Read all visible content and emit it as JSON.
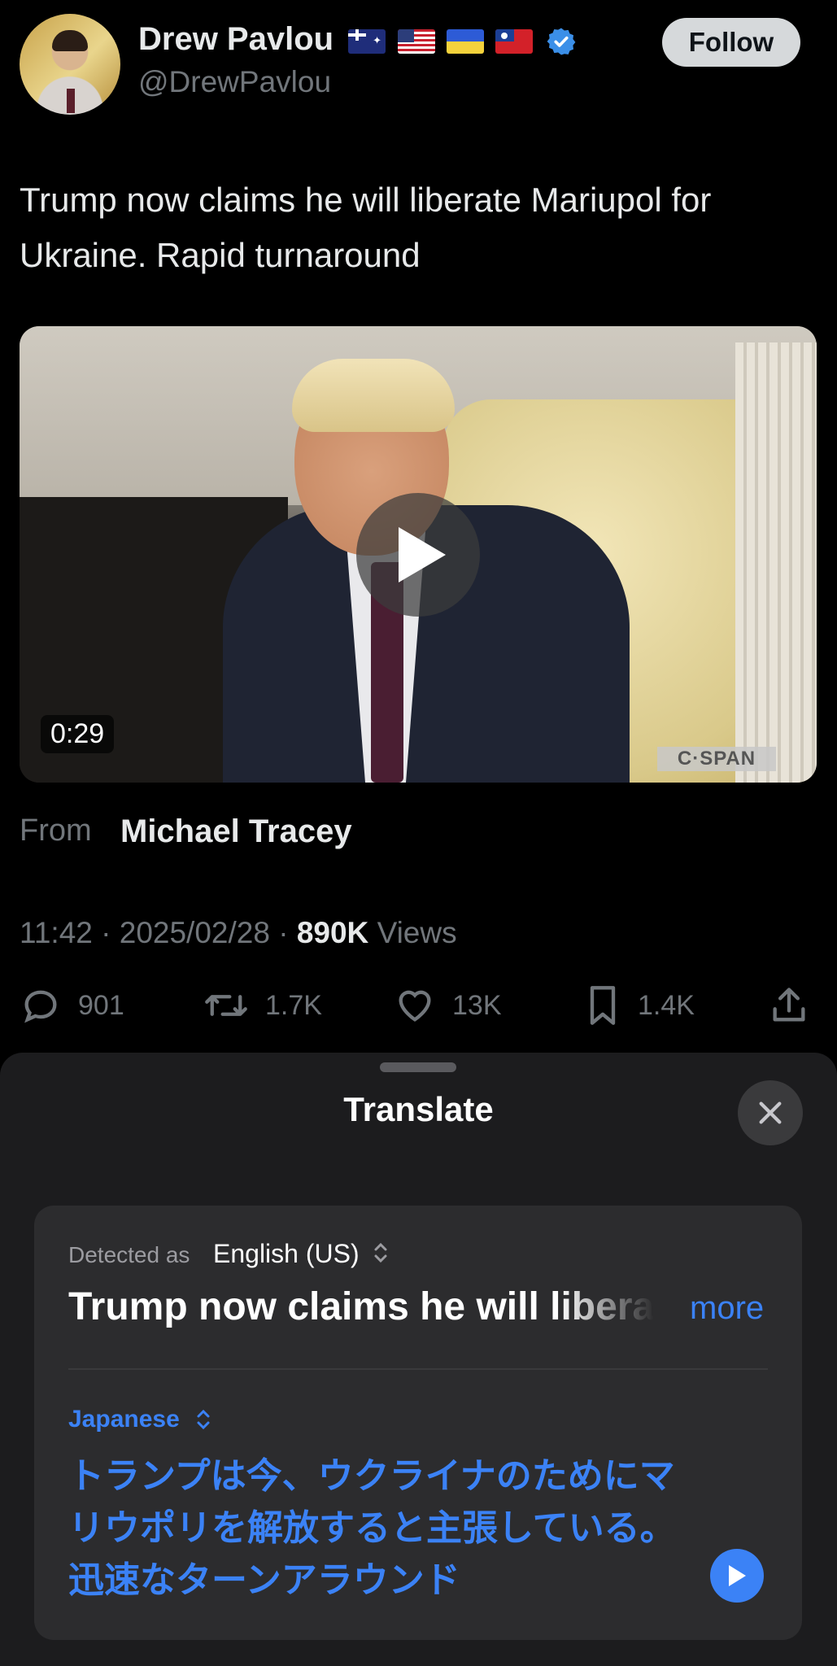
{
  "post": {
    "author_name": "Drew Pavlou",
    "author_handle": "@DrewPavlou",
    "follow_label": "Follow",
    "text": "Trump now claims he will liberate Mariupol for Ukraine. Rapid turnaround",
    "video": {
      "duration": "0:29",
      "watermark": "C·SPAN"
    },
    "from_label": "From",
    "from_name": "Michael Tracey",
    "time": "11:42",
    "date": "2025/02/28",
    "views_count": "890K",
    "views_label": "Views",
    "separator": "·",
    "stats": {
      "replies": "901",
      "reposts": "1.7K",
      "likes": "13K",
      "bookmarks": "1.4K"
    },
    "flags": [
      "australia-flag-icon",
      "usa-flag-icon",
      "ukraine-flag-icon",
      "taiwan-flag-icon"
    ]
  },
  "translate": {
    "title": "Translate",
    "detected_label": "Detected as",
    "detected_language": "English (US)",
    "source_text": "Trump now claims he will liberate Mariupol for Ukraine. Rapid turnaround",
    "more_label": "more",
    "target_language": "Japanese",
    "translated_text": "トランプは今、ウクライナのためにマリウポリを解放すると主張している。迅速なターンアラウンド"
  },
  "colors": {
    "accent": "#3b82f6",
    "muted": "#71767b",
    "sheet": "#1c1c1e",
    "card": "#2c2c2e"
  }
}
